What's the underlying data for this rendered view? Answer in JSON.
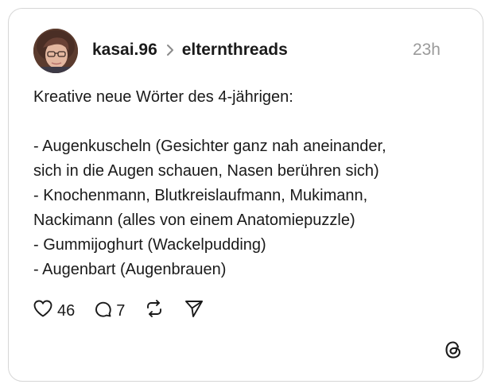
{
  "post": {
    "author": "kasai.96",
    "community": "elternthreads",
    "timestamp": "23h",
    "lines": [
      "Kreative neue Wörter des 4-jährigen:",
      "",
      "- Augenkuscheln (Gesichter ganz nah aneinander,",
      "sich in die Augen schauen, Nasen berühren sich)",
      "- Knochenmann, Blutkreislaufmann, Mukimann,",
      "Nackimann (alles von einem Anatomiepuzzle)",
      "- Gummijoghurt (Wackelpudding)",
      "- Augenbart (Augenbrauen)"
    ]
  },
  "actions": {
    "likes": "46",
    "replies": "7"
  },
  "icons": {
    "like": "heart-icon",
    "reply": "speech-bubble-icon",
    "repost": "repost-icon",
    "share": "send-icon",
    "brand": "threads-logo-icon"
  }
}
